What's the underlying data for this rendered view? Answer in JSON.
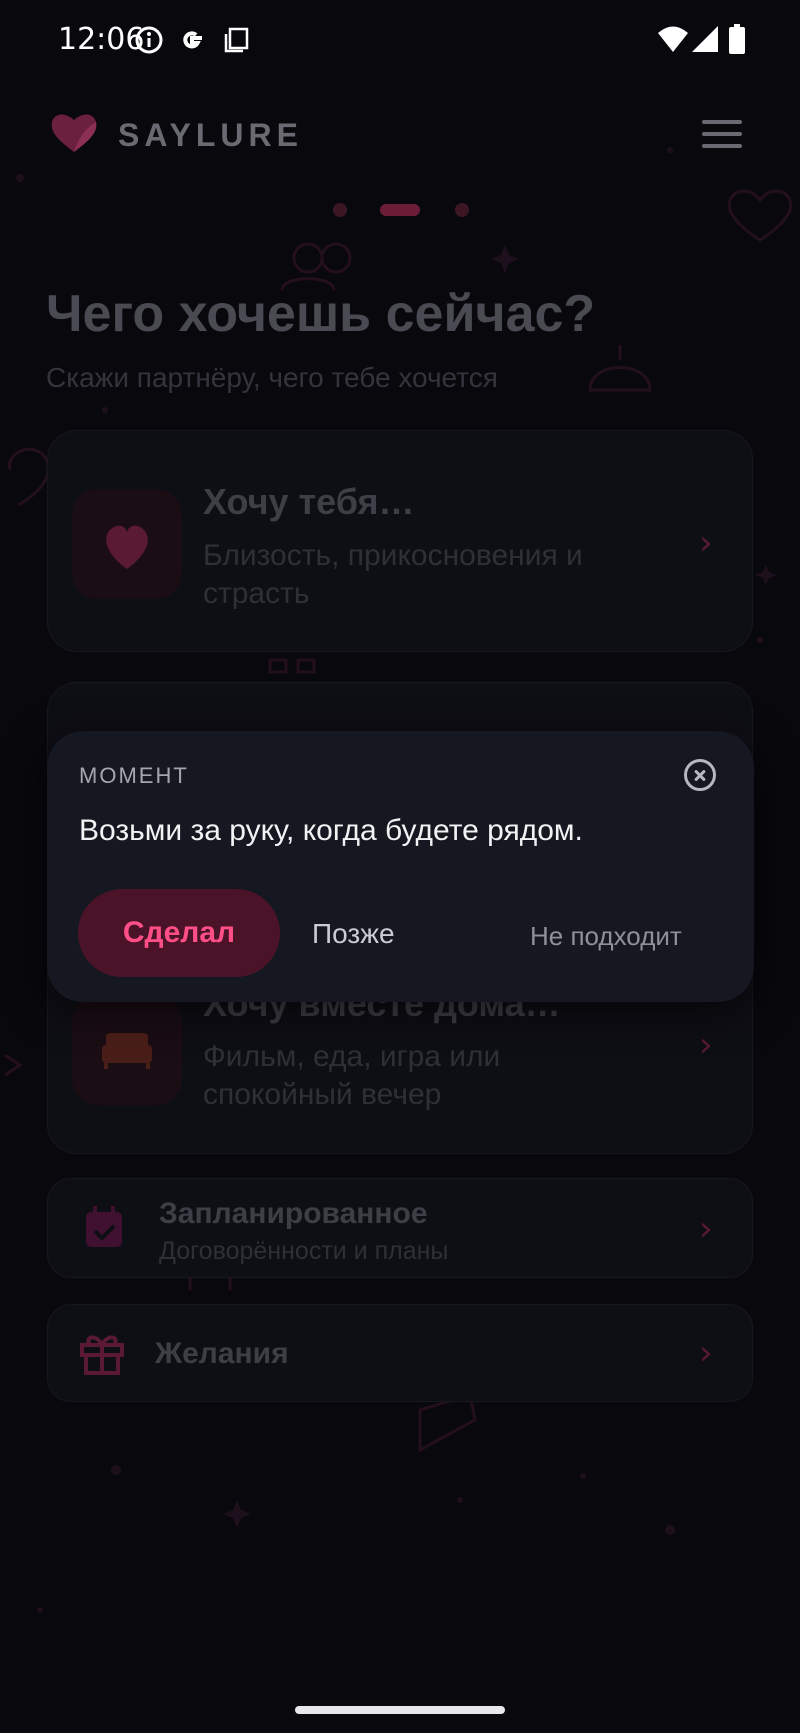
{
  "status_bar": {
    "time": "12:06"
  },
  "app": {
    "name": "SAYLURE"
  },
  "header": {
    "title": "Чего хочешь сейчас?",
    "subtitle": "Скажи партнёру, чего тебе хочется"
  },
  "pager": {
    "count": 3,
    "active_index": 1
  },
  "cards": [
    {
      "title": "Хочу тебя…",
      "description": "Близость, прикосновения и страсть",
      "icon": "heart-icon"
    },
    {
      "title": "Хочу вместе дома…",
      "description": "Фильм, еда, игра или спокойный вечер",
      "icon": "sofa-icon"
    }
  ],
  "rows": [
    {
      "title": "Запланированное",
      "subtitle": "Договорённости и планы",
      "icon": "calendar-check-icon"
    },
    {
      "title": "Желания",
      "icon": "gift-icon"
    }
  ],
  "dialog": {
    "label": "МОМЕНТ",
    "text": "Возьми за руку, когда будете рядом.",
    "done_label": "Сделал",
    "later_label": "Позже",
    "not_fit_label": "Не подходит"
  },
  "colors": {
    "accent": "#ff4f86",
    "accent_bg": "#4b1328",
    "dialog_bg": "#151820",
    "screen_bg": "#08080d"
  }
}
